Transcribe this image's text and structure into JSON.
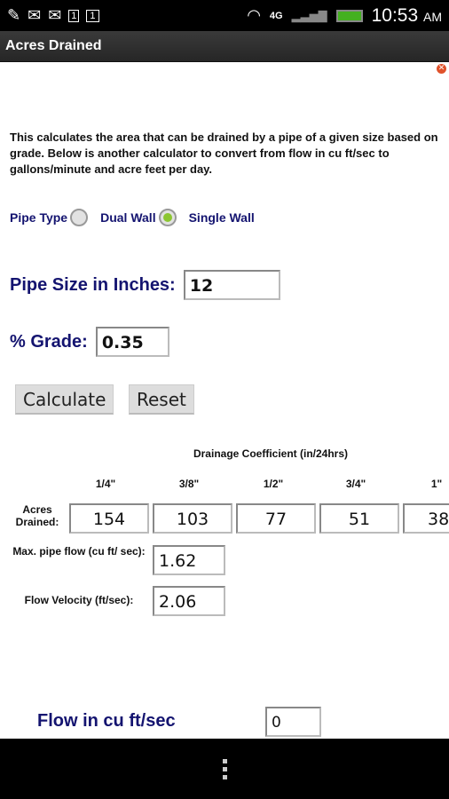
{
  "status_bar": {
    "time": "10:53",
    "ampm": "AM",
    "network": "4G",
    "icons": [
      "evernote-icon",
      "gmail-icon",
      "gmail-icon",
      "calendar-icon",
      "calendar-icon",
      "wifi-icon",
      "signal-icon",
      "battery-icon"
    ],
    "calendar_day": "1"
  },
  "app": {
    "title": "Acres Drained"
  },
  "description": "This calculates the area that can be drained by a pipe of a given size based on grade. Below is another calculator to convert from flow in cu ft/sec to gallons/minute and acre feet per day.",
  "pipe_type": {
    "label": "Pipe Type",
    "options": [
      {
        "label": "Dual Wall",
        "checked": false
      },
      {
        "label": "Single Wall",
        "checked": true
      }
    ]
  },
  "pipe_size": {
    "label": "Pipe Size in Inches:",
    "value": "12"
  },
  "grade": {
    "label": "% Grade:",
    "value": "0.35"
  },
  "buttons": {
    "calculate": "Calculate",
    "reset": "Reset"
  },
  "results": {
    "heading": "Drainage Coefficient (in/24hrs)",
    "coefficients": [
      "1/4\"",
      "3/8\"",
      "1/2\"",
      "3/4\"",
      "1\""
    ],
    "acres_label": "Acres Drained:",
    "acres": [
      "154",
      "103",
      "77",
      "51",
      "38"
    ],
    "max_flow_label": "Max. pipe flow (cu ft/ sec):",
    "max_flow": "1.62",
    "velocity_label": "Flow Velocity (ft/sec):",
    "velocity": "2.06"
  },
  "flow": {
    "label": "Flow in cu ft/sec",
    "value": "0"
  },
  "colors": {
    "accent_navy": "#141470",
    "radio_selected": "#8cc631"
  }
}
